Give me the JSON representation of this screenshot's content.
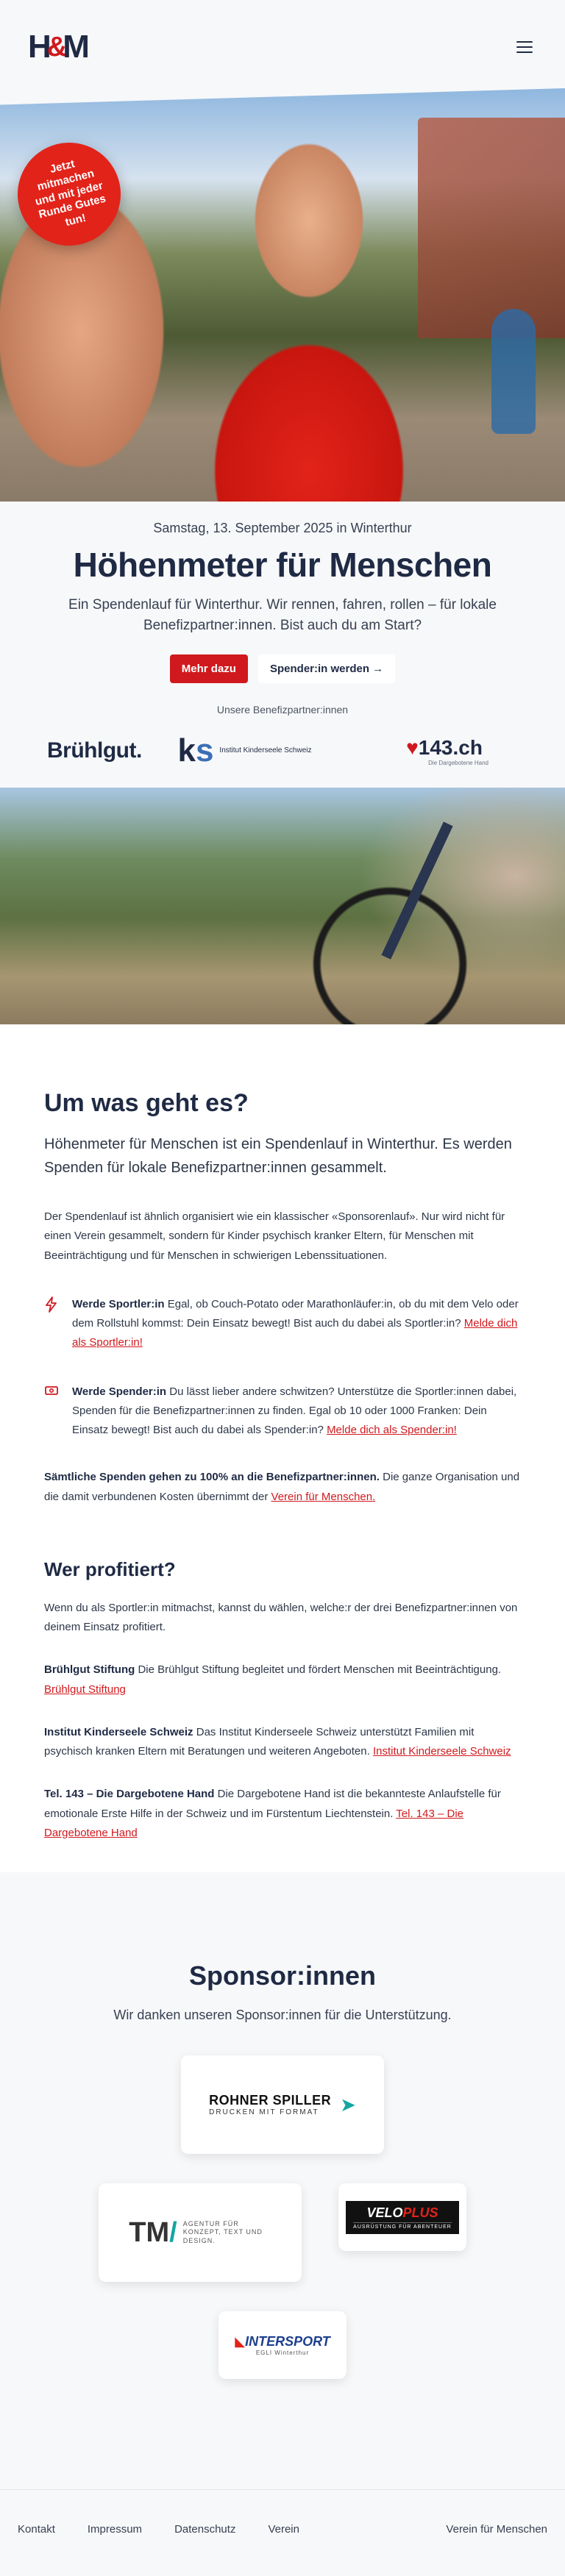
{
  "header": {
    "logo_left": "H",
    "logo_amp": "&",
    "logo_right": "M"
  },
  "hero": {
    "badge": "Jetzt mitmachen und mit jeder Runde Gutes tun!"
  },
  "intro": {
    "date": "Samstag, 13. September 2025 in Winterthur",
    "title": "Höhenmeter für Menschen",
    "lead": "Ein Spendenlauf für Winterthur. Wir rennen, fahren, rollen – für lokale Benefizpartner:innen. Bist auch du am Start?",
    "cta_primary": "Mehr dazu",
    "cta_secondary": "Spender:in werden →",
    "partners_label": "Unsere Benefizpartner:innen"
  },
  "partner_logos": {
    "bruehlgut": "Brühlgut.",
    "ks_mark_k": "k",
    "ks_mark_s": "s",
    "ks_text": "Institut Kinderseele Schweiz",
    "tel_num": "143",
    "tel_suffix": ".ch",
    "tel_sub": "Die Dargebotene Hand"
  },
  "about": {
    "title": "Um was geht es?",
    "lead": "Höhenmeter für Menschen ist ein Spendenlauf in Winterthur. Es werden Spenden für lokale Benefizpartner:innen gesammelt.",
    "body": "Der Spendenlauf ist ähnlich organisiert wie ein klassischer «Sponsorenlauf». Nur wird nicht für einen Verein gesammelt, sondern für Kinder psychisch kranker Eltern, für Menschen mit Beeinträchtigung und für Menschen in schwierigen Lebenssituationen.",
    "f1_title": "Werde Sportler:in",
    "f1_text": " Egal, ob Couch-Potato oder Marathonläufer:in, ob du mit dem Velo oder dem Rollstuhl kommst: Dein Einsatz bewegt! Bist auch du dabei als Sportler:in? ",
    "f1_link": "Melde dich als Sportler:in!",
    "f2_title": "Werde Spender:in",
    "f2_text": " Du lässt lieber andere schwitzen? Unterstütze die Sportler:innen dabei, Spenden für die Benefizpartner:innen zu finden. Egal ob 10 oder 1000 Franken: Dein Einsatz bewegt! Bist auch du dabei als Spender:in? ",
    "f2_link": "Melde dich als Spender:in!",
    "note_bold": "Sämtliche Spenden gehen zu 100% an die Benefizpartner:innen.",
    "note_text": " Die ganze Organisation und die damit verbundenen Kosten übernimmt der ",
    "note_link": "Verein für Menschen.",
    "profit_title": "Wer profitiert?",
    "profit_intro": "Wenn du als Sportler:in mitmachst, kannst du wählen, welche:r der drei Benefizpartner:innen von deinem Einsatz profitiert.",
    "b1_title": "Brühlgut Stiftung",
    "b1_text": " Die Brühlgut Stiftung begleitet und fördert Menschen mit Beeinträchtigung. ",
    "b1_link": "Brühlgut Stiftung",
    "b2_title": "Institut Kinderseele Schweiz",
    "b2_text": " Das Institut Kinderseele Schweiz unterstützt Familien mit psychisch kranken Eltern mit Beratungen und weiteren Angeboten. ",
    "b2_link": "Institut Kinderseele Schweiz",
    "b3_title": "Tel. 143 – Die Dargebotene Hand",
    "b3_text": " Die Dargebotene Hand ist die bekannteste Anlaufstelle für emotionale Erste Hilfe in der Schweiz und im Fürstentum Liechtenstein. ",
    "b3_link": "Tel. 143 – Die Dargebotene Hand"
  },
  "sponsors": {
    "title": "Sponsor:innen",
    "subtitle": "Wir danken unseren Sponsor:innen für die Unterstützung.",
    "rohner_title": "ROHNER SPILLER",
    "rohner_sub": "DRUCKEN MIT FORMAT",
    "tm_title": "TM",
    "tm_slash": "/",
    "tm_sub": "AGENTUR FÜR KONZEPT, TEXT UND DESIGN.",
    "velo_a": "VELO",
    "velo_b": "PLUS",
    "velo_sub": "AUSRÜSTUNG FÜR ABENTEUER",
    "intersport": "INTERSPORT",
    "intersport_sub": "EGLI Winterthur"
  },
  "footer": {
    "links": [
      "Kontakt",
      "Impressum",
      "Datenschutz",
      "Verein"
    ],
    "right": "Verein für Menschen"
  },
  "colors": {
    "accent": "#d0191e",
    "navy": "#1f2a44"
  }
}
